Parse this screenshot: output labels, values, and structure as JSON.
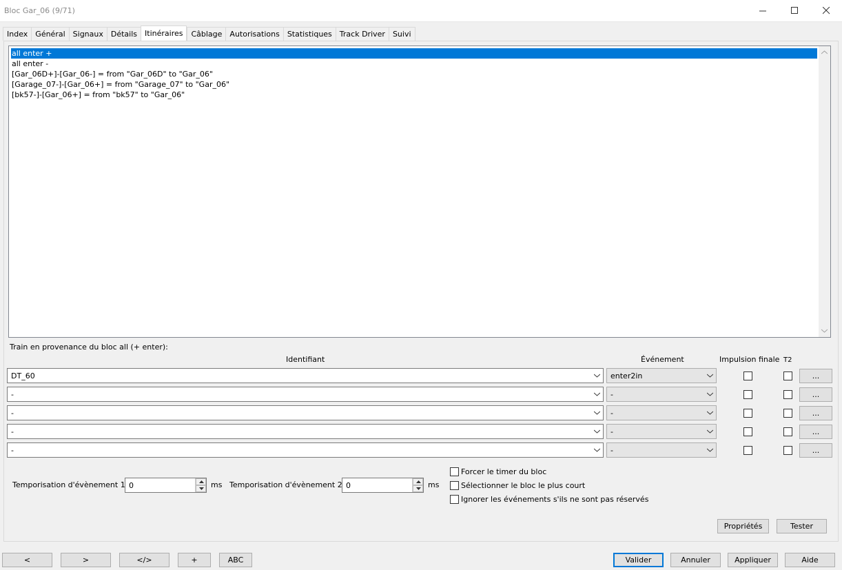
{
  "window": {
    "title": "Bloc Gar_06 (9/71)"
  },
  "tabs": [
    {
      "label": "Index"
    },
    {
      "label": "Général"
    },
    {
      "label": "Signaux"
    },
    {
      "label": "Détails"
    },
    {
      "label": "Itinéraires",
      "active": true
    },
    {
      "label": "Câblage"
    },
    {
      "label": "Autorisations"
    },
    {
      "label": "Statistiques"
    },
    {
      "label": "Track Driver"
    },
    {
      "label": "Suivi"
    }
  ],
  "routes": [
    {
      "text": "all enter +",
      "selected": true
    },
    {
      "text": "all enter -"
    },
    {
      "text": "[Gar_06D+]-[Gar_06-] = from \"Gar_06D\" to \"Gar_06\""
    },
    {
      "text": "[Garage_07-]-[Gar_06+] = from \"Garage_07\" to \"Gar_06\""
    },
    {
      "text": "[bk57-]-[Gar_06+] = from \"bk57\" to \"Gar_06\""
    }
  ],
  "train_section": {
    "heading": "Train en provenance du bloc all (+ enter):",
    "col_identifiant": "Identifiant",
    "col_evenement": "Événement",
    "col_impulsion": "Impulsion finale",
    "col_t2": "T2",
    "rows": [
      {
        "identifiant": "DT_60",
        "evenement": "enter2in",
        "impulsion": false,
        "t2": false,
        "more": "..."
      },
      {
        "identifiant": "-",
        "evenement": "-",
        "impulsion": false,
        "t2": false,
        "more": "..."
      },
      {
        "identifiant": "-",
        "evenement": "-",
        "impulsion": false,
        "t2": false,
        "more": "..."
      },
      {
        "identifiant": "-",
        "evenement": "-",
        "impulsion": false,
        "t2": false,
        "more": "..."
      },
      {
        "identifiant": "-",
        "evenement": "-",
        "impulsion": false,
        "t2": false,
        "more": "..."
      }
    ]
  },
  "timers": {
    "label1": "Temporisation d'évènement 1",
    "value1": "0",
    "unit1": "ms",
    "label2": "Temporisation d'évènement 2",
    "value2": "0",
    "unit2": "ms"
  },
  "options": {
    "force_timer": {
      "label": "Forcer le timer du bloc",
      "checked": false
    },
    "shortest": {
      "label": "Sélectionner le bloc le plus court",
      "checked": false
    },
    "ignore_events": {
      "label": "Ignorer les événements s'ils ne sont pas réservés",
      "checked": false
    }
  },
  "panel_buttons": {
    "properties": "Propriétés",
    "test": "Tester"
  },
  "footer": {
    "prev": "<",
    "next": ">",
    "code": "</>",
    "add": "+",
    "abc": "ABC",
    "ok": "Valider",
    "cancel": "Annuler",
    "apply": "Appliquer",
    "help": "Aide"
  },
  "colors": {
    "selection": "#0078d7",
    "default_button_border": "#0078d7"
  },
  "icons": [
    "minimize-icon",
    "maximize-icon",
    "close-icon",
    "chevron-down-icon",
    "spin-up-icon",
    "spin-down-icon",
    "scroll-up-icon",
    "scroll-down-icon"
  ]
}
